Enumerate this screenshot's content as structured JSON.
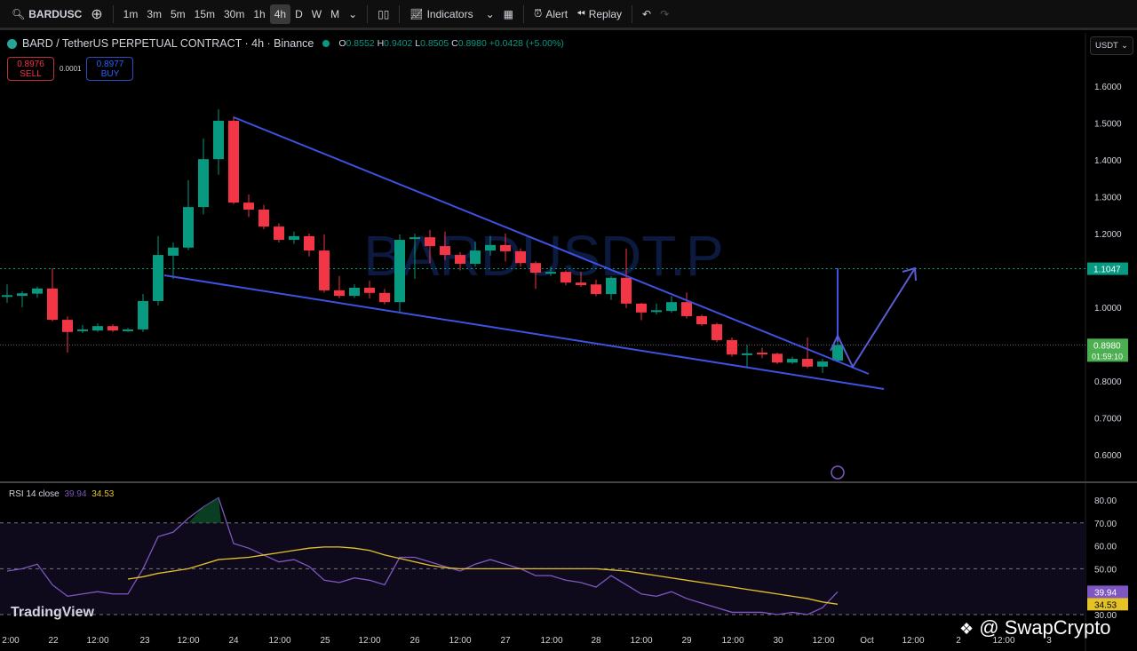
{
  "toolbar": {
    "symbol": "BARDUSC",
    "intervals": [
      "1m",
      "3m",
      "5m",
      "15m",
      "30m",
      "1h",
      "4h",
      "D",
      "W",
      "M"
    ],
    "active_interval": "4h",
    "indicators": "Indicators",
    "alert": "Alert",
    "replay": "Replay"
  },
  "legend": {
    "title": "BARD / TetherUS PERPETUAL CONTRACT · 4h · Binance",
    "o_label": "O",
    "o": "0.8552",
    "h_label": "H",
    "h": "0.9402",
    "l_label": "L",
    "l": "0.8505",
    "c_label": "C",
    "c": "0.8980",
    "change": "+0.0428 (+5.00%)"
  },
  "trade": {
    "sell_price": "0.8976",
    "sell_label": "SELL",
    "spread": "0.0001",
    "buy_price": "0.8977",
    "buy_label": "BUY"
  },
  "currency": "USDT",
  "watermark": "BARDUSDT.P",
  "logo": "TradingView",
  "credit": "@ SwapCrypto",
  "colors": {
    "up": "#089981",
    "down": "#f23645",
    "trendline": "#3f51e0",
    "rsi": "#7e57c2",
    "rsi_ma": "#e6c229",
    "bg": "#000000"
  },
  "chart_data": [
    {
      "type": "candlestick",
      "title": "BARD / TetherUS PERPETUAL CONTRACT · 4h · Binance",
      "x_start": "Sep 21 12:00",
      "interval": "4h",
      "ylim": [
        0.55,
        1.65
      ],
      "yticks": [
        "1.6000",
        "1.5000",
        "1.4000",
        "1.3000",
        "1.2000",
        "1.0000",
        "0.8000",
        "0.7000",
        "0.6000"
      ],
      "xticks": [
        "2:00",
        "22",
        "12:00",
        "23",
        "12:00",
        "24",
        "12:00",
        "25",
        "12:00",
        "26",
        "12:00",
        "27",
        "12:00",
        "28",
        "12:00",
        "29",
        "12:00",
        "30",
        "12:00",
        "Oct",
        "12:00",
        "2",
        "12:00",
        "3"
      ],
      "price_labels": [
        {
          "value": "1.1047",
          "color": "#089981"
        },
        {
          "value": "0.8980",
          "sub": "01:59:10",
          "color": "#4caf50"
        }
      ],
      "ohlc": [
        [
          1.03,
          1.062,
          1.012,
          1.033
        ],
        [
          1.031,
          1.044,
          1.0,
          1.038
        ],
        [
          1.037,
          1.056,
          1.026,
          1.051
        ],
        [
          1.051,
          1.106,
          0.962,
          0.966
        ],
        [
          0.966,
          0.975,
          0.877,
          0.933
        ],
        [
          0.937,
          0.952,
          0.93,
          0.94
        ],
        [
          0.937,
          0.956,
          0.933,
          0.949
        ],
        [
          0.949,
          0.954,
          0.933,
          0.937
        ],
        [
          0.937,
          0.944,
          0.933,
          0.94
        ],
        [
          0.94,
          1.036,
          0.933,
          1.017
        ],
        [
          1.017,
          1.193,
          1.005,
          1.142
        ],
        [
          1.14,
          1.176,
          1.077,
          1.162
        ],
        [
          1.162,
          1.345,
          1.155,
          1.272
        ],
        [
          1.272,
          1.458,
          1.252,
          1.402
        ],
        [
          1.402,
          1.537,
          1.36,
          1.506
        ],
        [
          1.506,
          1.518,
          1.28,
          1.284
        ],
        [
          1.284,
          1.306,
          1.245,
          1.265
        ],
        [
          1.265,
          1.278,
          1.212,
          1.219
        ],
        [
          1.219,
          1.228,
          1.176,
          1.183
        ],
        [
          1.183,
          1.205,
          1.172,
          1.193
        ],
        [
          1.193,
          1.2,
          1.138,
          1.154
        ],
        [
          1.154,
          1.198,
          1.04,
          1.046
        ],
        [
          1.046,
          1.085,
          1.025,
          1.031
        ],
        [
          1.031,
          1.062,
          1.026,
          1.053
        ],
        [
          1.053,
          1.072,
          1.024,
          1.039
        ],
        [
          1.039,
          1.05,
          1.008,
          1.014
        ],
        [
          1.014,
          1.198,
          0.985,
          1.183
        ],
        [
          1.186,
          1.2,
          1.077,
          1.19
        ],
        [
          1.19,
          1.21,
          1.12,
          1.166
        ],
        [
          1.166,
          1.205,
          1.128,
          1.142
        ],
        [
          1.142,
          1.15,
          1.1,
          1.118
        ],
        [
          1.118,
          1.178,
          1.11,
          1.154
        ],
        [
          1.154,
          1.194,
          1.14,
          1.169
        ],
        [
          1.169,
          1.2,
          1.124,
          1.152
        ],
        [
          1.152,
          1.16,
          1.11,
          1.12
        ],
        [
          1.12,
          1.125,
          1.05,
          1.094
        ],
        [
          1.094,
          1.11,
          1.085,
          1.096
        ],
        [
          1.096,
          1.1,
          1.06,
          1.067
        ],
        [
          1.067,
          1.096,
          1.055,
          1.06
        ],
        [
          1.062,
          1.075,
          1.03,
          1.036
        ],
        [
          1.036,
          1.085,
          1.02,
          1.08
        ],
        [
          1.08,
          1.159,
          0.998,
          1.01
        ],
        [
          1.01,
          1.012,
          0.965,
          0.986
        ],
        [
          0.99,
          1.01,
          0.98,
          0.992
        ],
        [
          0.99,
          1.03,
          0.985,
          1.014
        ],
        [
          1.014,
          1.04,
          0.97,
          0.976
        ],
        [
          0.976,
          0.98,
          0.95,
          0.954
        ],
        [
          0.954,
          0.958,
          0.905,
          0.911
        ],
        [
          0.911,
          0.918,
          0.866,
          0.872
        ],
        [
          0.873,
          0.898,
          0.835,
          0.875
        ],
        [
          0.877,
          0.89,
          0.862,
          0.874
        ],
        [
          0.874,
          0.877,
          0.846,
          0.85
        ],
        [
          0.85,
          0.866,
          0.846,
          0.86
        ],
        [
          0.86,
          0.918,
          0.835,
          0.839
        ],
        [
          0.839,
          0.86,
          0.822,
          0.853
        ],
        [
          0.8552,
          0.9402,
          0.8505,
          0.898
        ]
      ],
      "horizontal_lines": [
        1.1047,
        0.898
      ]
    },
    {
      "type": "line",
      "title": "RSI 14 close",
      "ylim": [
        28,
        84
      ],
      "yticks": [
        "80.00",
        "70.00",
        "60.00",
        "50.00",
        "30.00"
      ],
      "bands": [
        30,
        50,
        70
      ],
      "series": [
        {
          "name": "39.94",
          "color": "#7e57c2",
          "values": [
            49,
            50,
            52,
            43,
            38,
            39,
            40,
            39,
            39,
            50,
            64,
            66,
            72,
            77,
            81,
            61,
            59,
            56,
            53,
            54,
            51,
            45,
            44,
            46,
            45,
            43,
            55,
            55,
            53,
            51,
            49,
            52,
            54,
            52,
            50,
            47,
            47,
            45,
            44,
            42,
            47,
            43,
            39,
            38,
            40,
            37,
            35,
            33,
            31,
            31,
            31,
            30,
            31,
            30,
            33,
            39.94
          ]
        },
        {
          "name": "34.53",
          "color": "#e6c229",
          "values": [
            null,
            null,
            null,
            null,
            null,
            null,
            null,
            null,
            45.5,
            46.5,
            48,
            49,
            50,
            52,
            54,
            54.5,
            55,
            56,
            57,
            58,
            59,
            59.5,
            59.5,
            59,
            58,
            56,
            54.5,
            53,
            51.5,
            50.5,
            50,
            50,
            50,
            50,
            50,
            50,
            50,
            50,
            50,
            50,
            49.5,
            49,
            48,
            47,
            46,
            45,
            44,
            43,
            42,
            41,
            40,
            39,
            38,
            37,
            35.5,
            34.53
          ]
        }
      ]
    }
  ]
}
